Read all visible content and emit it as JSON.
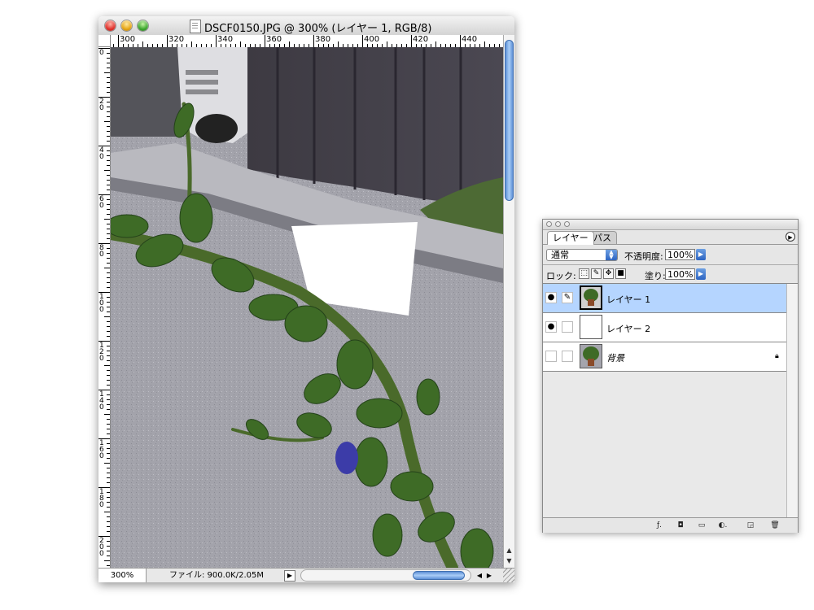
{
  "document_window": {
    "title": "DSCF0150.JPG @ 300% (レイヤー 1, RGB/8)",
    "ruler_h_labels": [
      "300",
      "320",
      "340",
      "360",
      "380",
      "400",
      "420",
      "440"
    ],
    "ruler_v_labels": [
      "0",
      "20",
      "40",
      "60",
      "80",
      "100",
      "120",
      "140",
      "160",
      "180",
      "200"
    ],
    "zoom": "300%",
    "file_info": "ファイル: 900.0K/2.05M"
  },
  "layers_palette": {
    "tabs": [
      "レイヤー",
      "パス"
    ],
    "blend_mode": "通常",
    "opacity_label": "不透明度:",
    "opacity_value": "100%",
    "lock_label": "ロック:",
    "fill_label": "塗り:",
    "fill_value": "100%",
    "layers": [
      {
        "name": "レイヤー 1",
        "visible": true,
        "selected": true
      },
      {
        "name": "レイヤー 2",
        "visible": true,
        "selected": false
      },
      {
        "name": "背景",
        "visible": false,
        "selected": false,
        "locked": true
      }
    ]
  },
  "icons": [
    "close-light",
    "minimize-light",
    "zoom-light",
    "document-icon",
    "eye-icon",
    "brush-icon",
    "lock-icon",
    "palette-menu-icon",
    "layer-style-icon",
    "mask-icon",
    "folder-icon",
    "adjustment-icon",
    "new-layer-icon",
    "trash-icon"
  ],
  "colors": {
    "selection": "#b5d5ff",
    "scroll_blue": "#5d8fd6"
  }
}
